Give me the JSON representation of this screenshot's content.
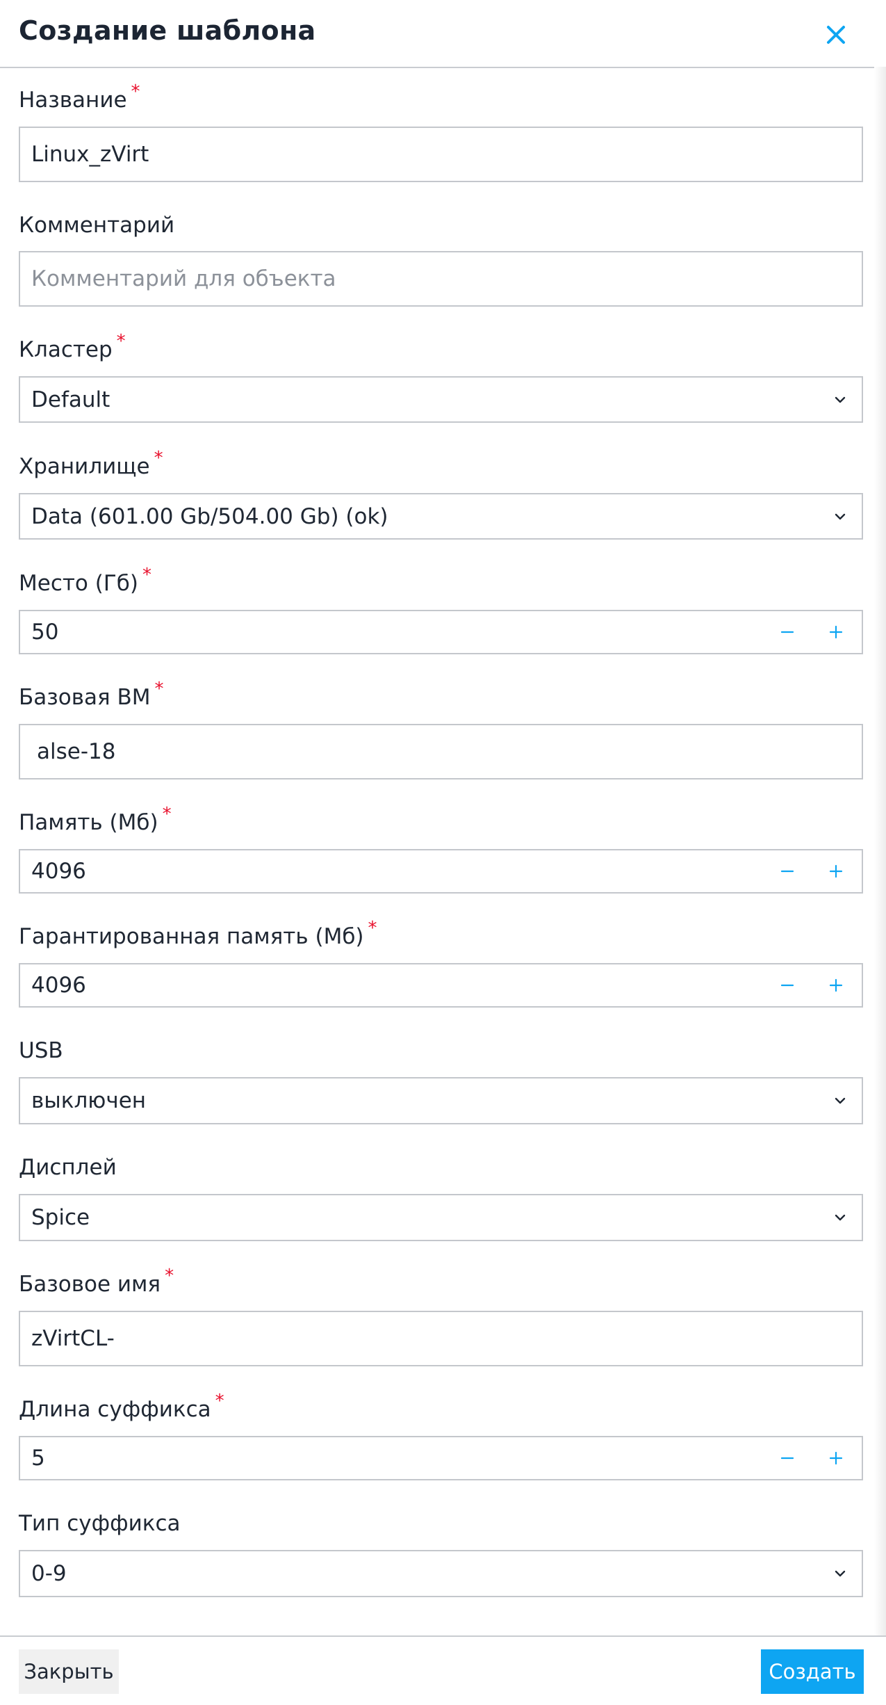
{
  "dialog": {
    "title": "Создание шаблона",
    "icons": {
      "close": "close-icon",
      "select_arrow": "chevron-down-icon",
      "minus": "minus-icon",
      "plus": "plus-icon"
    },
    "colors": {
      "accent": "#0ea5f2",
      "required": "#e8112d",
      "title": "#1c2533",
      "border": "#c4c7cc"
    }
  },
  "fields": {
    "name": {
      "label": "Название",
      "required": "*",
      "value": "Linux_zVirt"
    },
    "comment": {
      "label": "Комментарий",
      "placeholder": "Комментарий для объекта",
      "value": ""
    },
    "cluster": {
      "label": "Кластер",
      "required": "*",
      "value": "Default"
    },
    "storage": {
      "label": "Хранилище",
      "required": "*",
      "value": "Data (601.00 Gb/504.00 Gb) (ok)"
    },
    "space": {
      "label": "Место (Гб)",
      "required": "*",
      "value": "50"
    },
    "base_vm": {
      "label": "Базовая ВМ",
      "required": "*",
      "value": "alse-18"
    },
    "memory": {
      "label": "Память (Мб)",
      "required": "*",
      "value": "4096"
    },
    "guaranteed_memory": {
      "label": "Гарантированная память (Мб)",
      "required": "*",
      "value": "4096"
    },
    "usb": {
      "label": "USB",
      "value": "выключен"
    },
    "display": {
      "label": "Дисплей",
      "value": "Spice"
    },
    "base_name": {
      "label": "Базовое имя",
      "required": "*",
      "value": "zVirtCL-"
    },
    "suffix_length": {
      "label": "Длина суффикса",
      "required": "*",
      "value": "5"
    },
    "suffix_type": {
      "label": "Тип суффикса",
      "value": "0-9"
    }
  },
  "footer": {
    "close_label": "Закрыть",
    "create_label": "Создать"
  }
}
